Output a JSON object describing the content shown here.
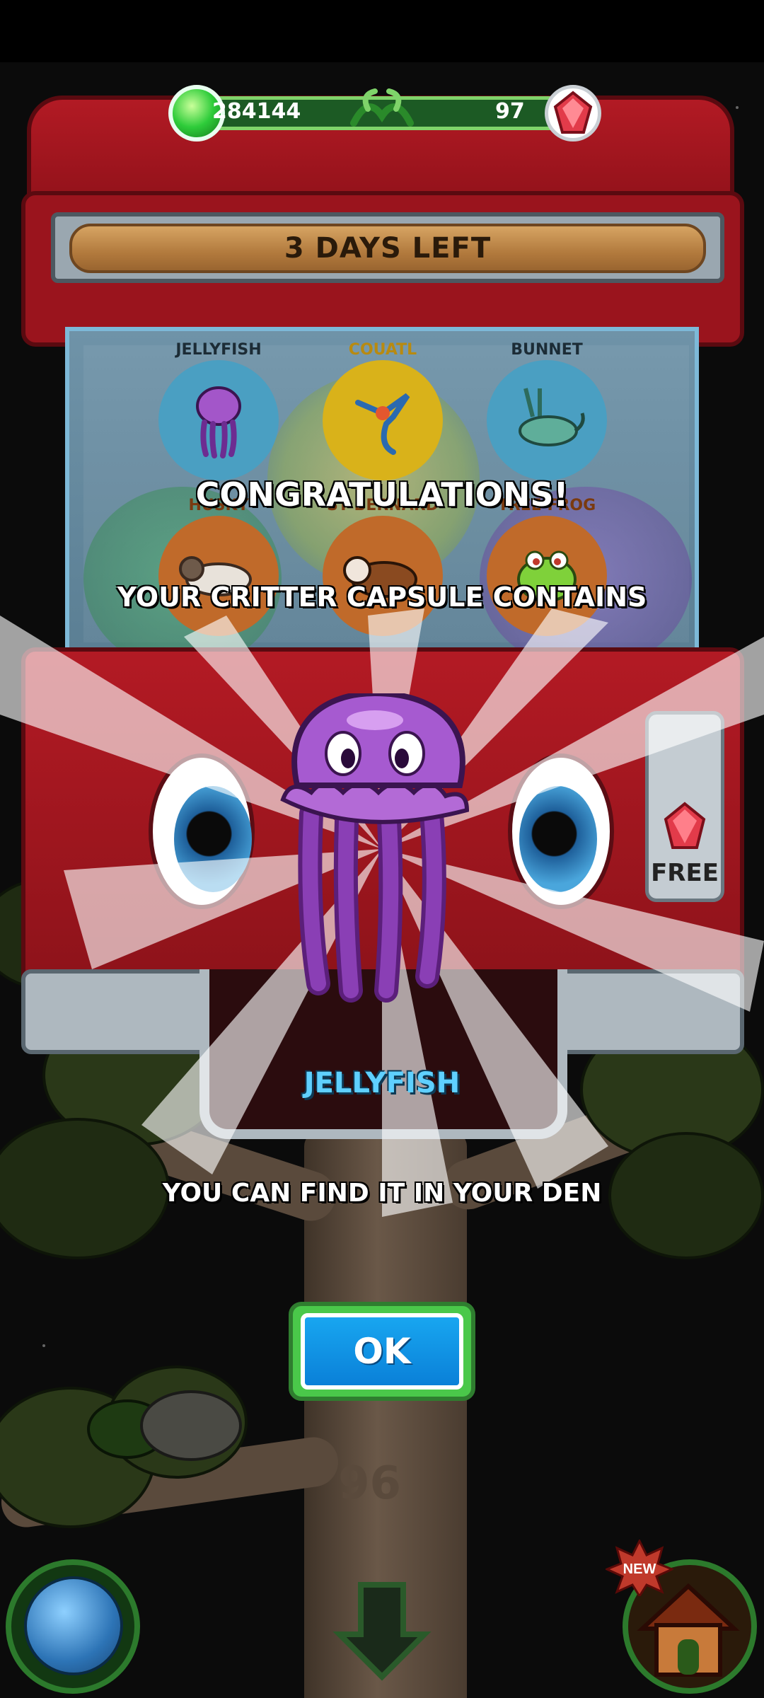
{
  "currency": {
    "goo": "284144",
    "gems": "97"
  },
  "banner": {
    "text": "3 DAYS LEFT"
  },
  "capsule_contents": [
    {
      "name": "JELLYFISH",
      "color": "#3a93b8"
    },
    {
      "name": "COUATL",
      "color": "#d9b21a"
    },
    {
      "name": "BUNNET",
      "color": "#3a93b8"
    },
    {
      "name": "HUSKY",
      "color": "#c06a2a"
    },
    {
      "name": "ST BERNARD",
      "color": "#c06a2a"
    },
    {
      "name": "TREE FROG",
      "color": "#c06a2a"
    }
  ],
  "side_panel": {
    "label": "FREE"
  },
  "popup": {
    "title": "CONGRATULATIONS!",
    "subtitle": "YOUR CRITTER CAPSULE CONTAINS",
    "critter_name": "JELLYFISH",
    "message": "YOU CAN FIND IT IN YOUR DEN",
    "button": "OK"
  },
  "tree_level": "96",
  "bottom_nav": {
    "new_badge": "NEW"
  },
  "colors": {
    "machine_red": "#a5171f",
    "ok_blue": "#0f93e6",
    "accent_green": "#4ac84a",
    "critter_purple": "#9b3fc4"
  }
}
